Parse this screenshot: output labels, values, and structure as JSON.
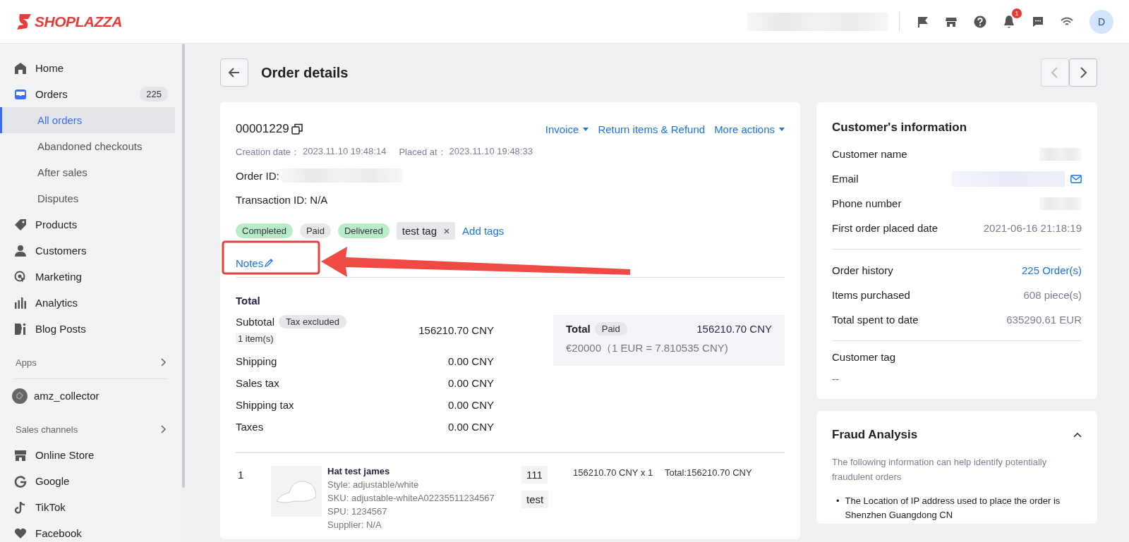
{
  "header": {
    "logo": "SHOPLAZZA",
    "notification_count": "1",
    "avatar": "D"
  },
  "sidebar": {
    "items": [
      {
        "kind": "nav",
        "label": "Home",
        "selected": false
      },
      {
        "kind": "nav",
        "label": "Orders",
        "badge": "225",
        "selected": false
      },
      {
        "kind": "sub",
        "label": "All orders",
        "selected": true
      },
      {
        "kind": "sub",
        "label": "Abandoned checkouts",
        "selected": false
      },
      {
        "kind": "sub",
        "label": "After sales",
        "selected": false
      },
      {
        "kind": "sub",
        "label": "Disputes",
        "selected": false
      },
      {
        "kind": "nav",
        "label": "Products",
        "selected": false
      },
      {
        "kind": "nav",
        "label": "Customers",
        "selected": false
      },
      {
        "kind": "nav",
        "label": "Marketing",
        "selected": false
      },
      {
        "kind": "nav",
        "label": "Analytics",
        "selected": false
      },
      {
        "kind": "nav",
        "label": "Blog Posts",
        "selected": false
      },
      {
        "kind": "section",
        "label": "Apps"
      },
      {
        "kind": "app",
        "label": "amz_collector",
        "selected": false
      },
      {
        "kind": "section",
        "label": "Sales channels"
      },
      {
        "kind": "nav",
        "label": "Online Store",
        "selected": false
      },
      {
        "kind": "nav",
        "label": "Google",
        "selected": false
      },
      {
        "kind": "nav",
        "label": "TikTok",
        "selected": false
      },
      {
        "kind": "nav",
        "label": "Facebook",
        "selected": false
      }
    ]
  },
  "page": {
    "title": "Order details"
  },
  "order": {
    "number": "00001229",
    "actions": [
      {
        "label": "Invoice",
        "dropdown": true
      },
      {
        "label": "Return items & Refund",
        "dropdown": false
      },
      {
        "label": "More actions",
        "dropdown": true
      }
    ],
    "creation_label": "Creation date：",
    "creation_value": "2023.11.10 19:48:14",
    "placed_label": "Placed at：",
    "placed_value": "2023.11.10 19:48:33",
    "order_id_label": "Order ID:",
    "transaction": "Transaction ID: N/A",
    "statuses": [
      {
        "label": "Completed",
        "color": "#b8ebc8"
      },
      {
        "label": "Paid",
        "color": "#e8e8ea"
      },
      {
        "label": "Delivered",
        "color": "#b8ebc8"
      }
    ],
    "tags": [
      "test tag"
    ],
    "add_tags": "Add tags",
    "notes": "Notes"
  },
  "totals": {
    "heading": "Total",
    "subtotal_label": "Subtotal",
    "tax_badge": "Tax excluded",
    "item_count": "1 item(s)",
    "subtotal": "156210.70 CNY",
    "rows": [
      {
        "label": "Shipping",
        "value": "0.00 CNY"
      },
      {
        "label": "Sales tax",
        "value": "0.00 CNY"
      },
      {
        "label": "Shipping tax",
        "value": "0.00 CNY"
      },
      {
        "label": "Taxes",
        "value": "0.00 CNY"
      }
    ],
    "summary": {
      "label": "Total",
      "badge": "Paid",
      "value": "156210.70 CNY",
      "exchange": "€20000（1 EUR = 7.810535 CNY)"
    }
  },
  "line_items": [
    {
      "index": "1",
      "name": "Hat test james",
      "details": [
        "Style: adjustable/white",
        "SKU: adjustable-whiteA02235511234567",
        "SPU: 1234567",
        "Supplier: N/A"
      ],
      "tags": [
        "111",
        "test"
      ],
      "price": "156210.70 CNY x 1",
      "total": "Total:156210.70 CNY"
    }
  ],
  "customer": {
    "title": "Customer's information",
    "rows": [
      {
        "label": "Customer name",
        "kind": "blurred"
      },
      {
        "label": "Email",
        "kind": "email"
      },
      {
        "label": "Phone number",
        "kind": "blurred"
      },
      {
        "label": "First order placed date",
        "kind": "text",
        "value": "2021-06-16 21:18:19"
      }
    ],
    "history": [
      {
        "label": "Order history",
        "kind": "link",
        "value": "225 Order(s)"
      },
      {
        "label": "Items purchased",
        "kind": "text",
        "value": "608 piece(s)"
      },
      {
        "label": "Total spent to date",
        "kind": "text",
        "value": "635290.61 EUR"
      }
    ],
    "tag_label": "Customer tag",
    "tag_value": "--"
  },
  "fraud": {
    "title": "Fraud Analysis",
    "expanded": true,
    "description": "The following information can help identify potentially fraudulent orders",
    "bullets": [
      {
        "marker": "•",
        "text": "The Location of IP address used to place the order is Shenzhen Guangdong CN"
      }
    ]
  }
}
